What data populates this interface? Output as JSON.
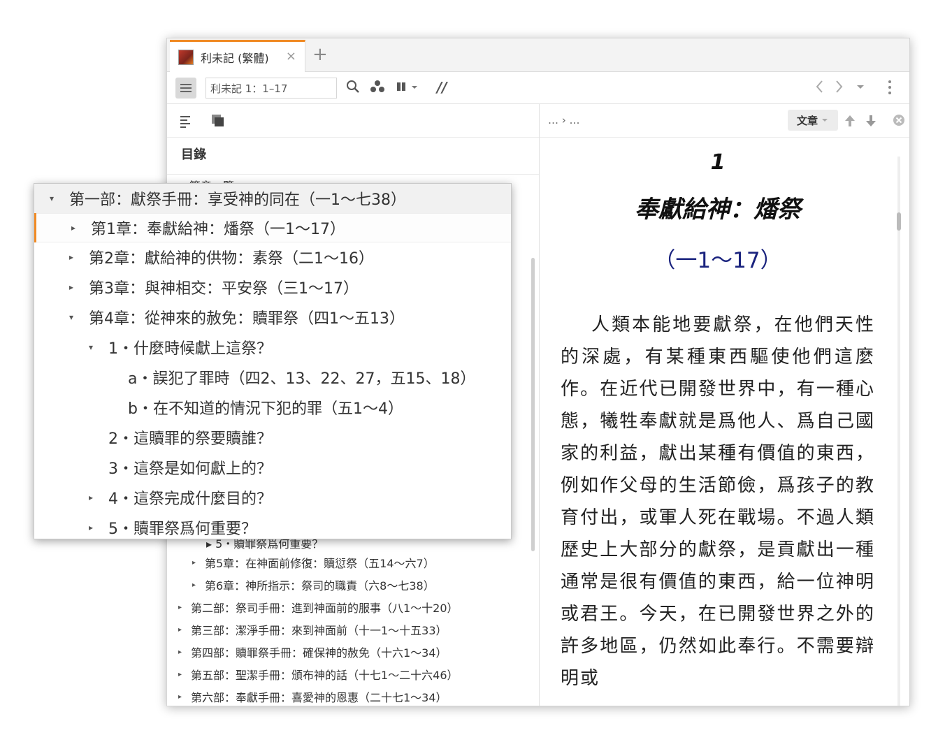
{
  "tab": {
    "title": "利未記 (繁體)",
    "close": "×",
    "add": "+"
  },
  "toolbar": {
    "reference": "利未記 1：1–17",
    "parallel_glyph": "//"
  },
  "left_pane": {
    "contents_label": "目錄",
    "first_item_partial": "篇章一覽",
    "toc_items": [
      {
        "label": "▸ 5・贖罪祭爲何重要？",
        "partial": true
      },
      {
        "label": "第5章：在神面前修復：贖愆祭（五14～六7）"
      },
      {
        "label": "第6章：神所指示：祭司的職責（六8～七38）"
      },
      {
        "label": "第二部：祭司手冊：進到神面前的服事（八1～十20）"
      },
      {
        "label": "第三部：潔淨手冊：來到神面前（十一1～十五33）"
      },
      {
        "label": "第四部：贖罪祭手冊：確保神的赦免（十六1～34）"
      },
      {
        "label": "第五部：聖潔手冊：頒布神的話（十七1～二十六46）"
      },
      {
        "label": "第六部：奉獻手冊：喜愛神的恩惠（二十七1～34）"
      }
    ]
  },
  "right_pane": {
    "breadcrumb": "… › …",
    "view_button": "文章",
    "chapter_number": "1",
    "chapter_title": "奉獻給神：燔祭",
    "chapter_range": "（一1～17）",
    "body": "人類本能地要獻祭，在他們天性的深處，有某種東西驅使他們這麼作。在近代已開發世界中，有一種心態，犧牲奉獻就是爲他人、爲自己國家的利益，獻出某種有價值的東西，例如作父母的生活節儉，爲孩子的教育付出，或軍人死在戰場。不過人類歷史上大部分的獻祭，是貢獻出一種通常是很有價值的東西，給一位神明或君王。今天，在已開發世界之外的許多地區，仍然如此奉行。不需要辯明或"
  },
  "zoom": {
    "rows": [
      {
        "label": "第一部：獻祭手冊：享受神的同在（一1～七38）",
        "expanded": true
      },
      {
        "label": "第1章：奉獻給神：燔祭（一1～17）",
        "expanded": false,
        "selected": true
      },
      {
        "label": "第2章：獻給神的供物：素祭（二1～16）",
        "expanded": false
      },
      {
        "label": "第3章：與神相交：平安祭（三1～17）",
        "expanded": false
      },
      {
        "label": "第4章：從神來的赦免：贖罪祭（四1～五13）",
        "expanded": true
      },
      {
        "label": "1・什麼時候獻上這祭？",
        "expanded": true
      },
      {
        "label": "a・誤犯了罪時（四2、13、22、27，五15、18）"
      },
      {
        "label": "b・在不知道的情況下犯的罪（五1～4）"
      },
      {
        "label": "2・這贖罪的祭要贖誰？"
      },
      {
        "label": "3・這祭是如何獻上的？"
      },
      {
        "label": "4・這祭完成什麼目的？",
        "expanded": false
      },
      {
        "label": "5・贖罪祭爲何重要？",
        "expanded": false
      }
    ]
  },
  "colors": {
    "accent": "#f08a24",
    "range_text": "#1a237e"
  }
}
